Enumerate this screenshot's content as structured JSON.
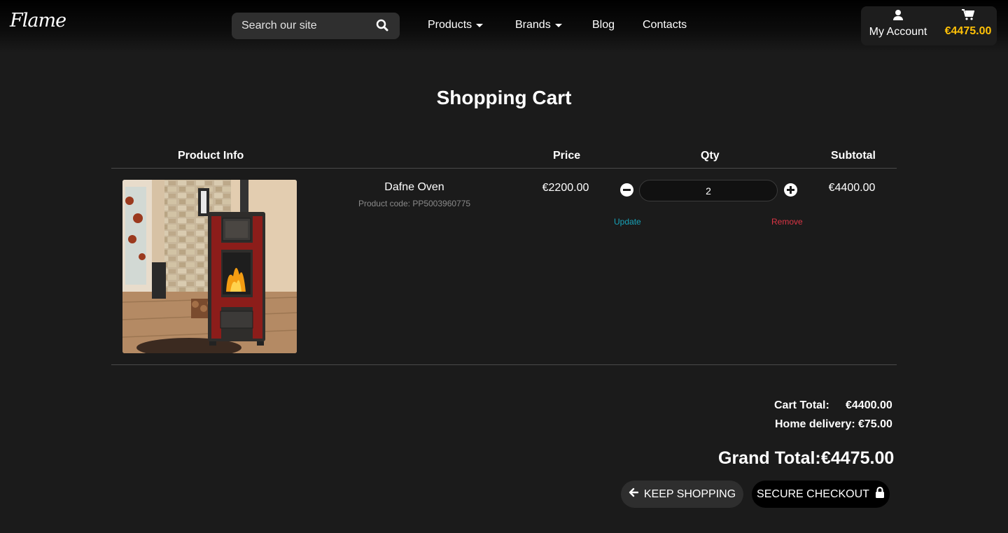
{
  "header": {
    "logo": "Flame",
    "search": {
      "placeholder": "Search our site",
      "value": ""
    },
    "nav": [
      {
        "label": "Products",
        "dropdown": true
      },
      {
        "label": "Brands",
        "dropdown": true
      },
      {
        "label": "Blog",
        "dropdown": false
      },
      {
        "label": "Contacts",
        "dropdown": false
      }
    ],
    "account": {
      "label": "My Account",
      "icon": "user-icon"
    },
    "cart": {
      "amount": "€4475.00",
      "icon": "cart-icon",
      "color": "#ffc107"
    }
  },
  "page": {
    "title": "Shopping Cart"
  },
  "table": {
    "headers": {
      "product_info": "Product Info",
      "price": "Price",
      "qty": "Qty",
      "subtotal": "Subtotal"
    },
    "rows": [
      {
        "name": "Dafne Oven",
        "code": "Product code: PP5003960775",
        "price": "€2200.00",
        "qty": "2",
        "update_label": "Update",
        "remove_label": "Remove",
        "subtotal": "€4400.00"
      }
    ]
  },
  "totals": {
    "cart_total_label": "Cart Total:",
    "cart_total_value": "€4400.00",
    "delivery_label": "Home delivery:",
    "delivery_value": "€75.00",
    "grand_total_label": "Grand Total:",
    "grand_total_value": "€4475.00"
  },
  "actions": {
    "keep_shopping": "KEEP SHOPPING",
    "secure_checkout": "SECURE CHECKOUT"
  },
  "colors": {
    "update_link": "#17a2b8",
    "remove_link": "#dc3545",
    "background": "#1b1b1b"
  }
}
